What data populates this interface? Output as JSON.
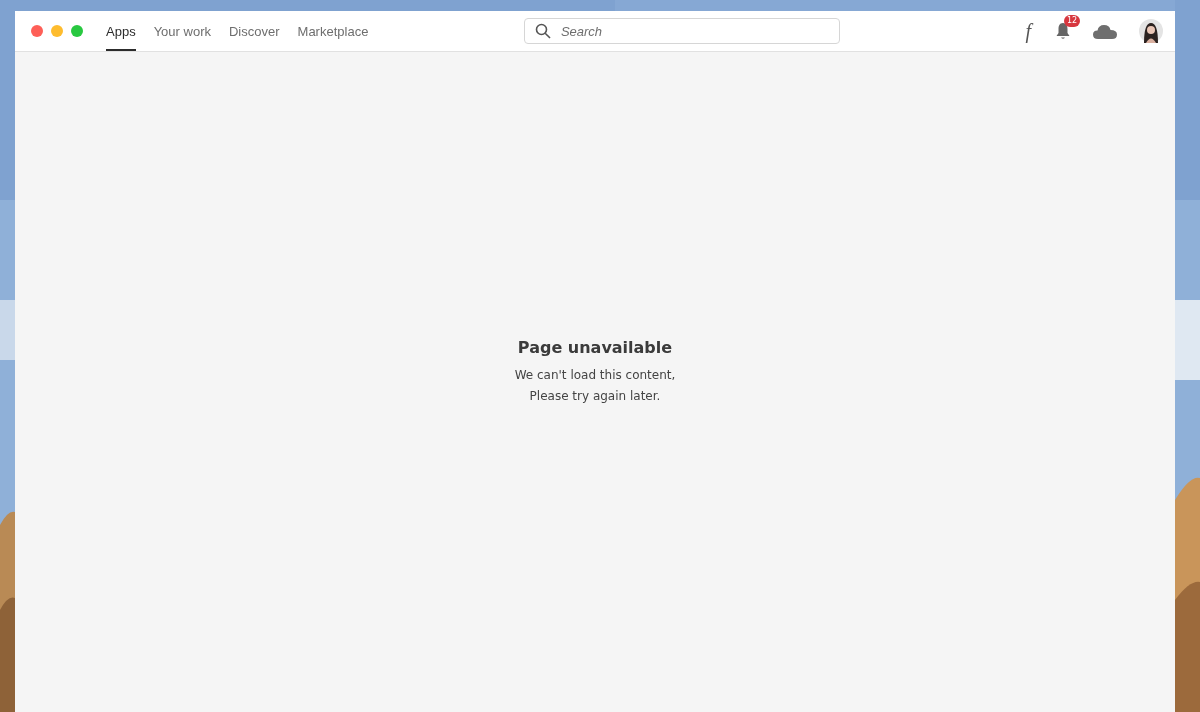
{
  "tabs": [
    {
      "label": "Apps",
      "selected": true
    },
    {
      "label": "Your work",
      "selected": false
    },
    {
      "label": "Discover",
      "selected": false
    },
    {
      "label": "Marketplace",
      "selected": false
    }
  ],
  "search": {
    "placeholder": "Search"
  },
  "toolbar": {
    "fonts_glyph": "f",
    "notification_count": "12"
  },
  "message": {
    "title": "Page unavailable",
    "body": "We can't load this content,\nPlease try again later."
  }
}
